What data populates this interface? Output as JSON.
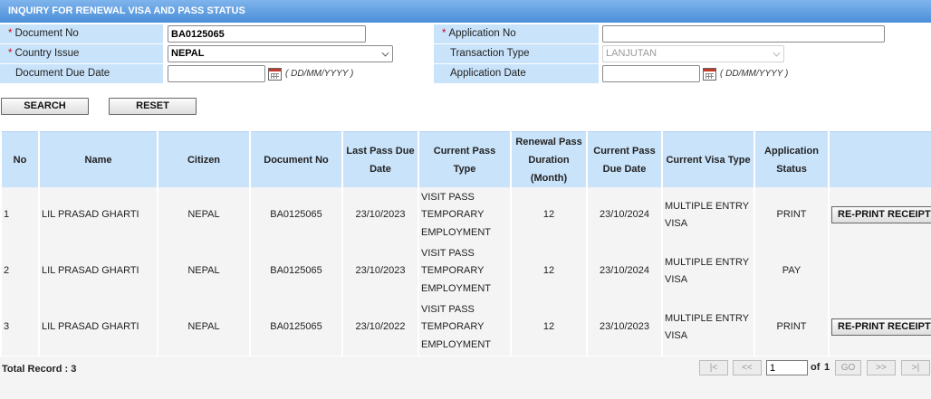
{
  "header": {
    "title": "INQUIRY FOR RENEWAL VISA AND PASS STATUS"
  },
  "form": {
    "required_mark": "*",
    "document_no": {
      "label": "Document No",
      "value": "BA0125065"
    },
    "application_no": {
      "label": "Application No",
      "value": ""
    },
    "country_issue": {
      "label": "Country Issue",
      "value": "NEPAL"
    },
    "transaction_type": {
      "label": "Transaction Type",
      "value": "LANJUTAN"
    },
    "document_due_date": {
      "label": "Document Due Date",
      "value": "",
      "hint": "( DD/MM/YYYY )"
    },
    "application_date": {
      "label": "Application Date",
      "value": "",
      "hint": "( DD/MM/YYYY )"
    },
    "search_label": "SEARCH",
    "reset_label": "RESET"
  },
  "table": {
    "headers": [
      "No",
      "Name",
      "Citizen",
      "Document No",
      "Last Pass Due Date",
      "Current Pass Type",
      "Renewal Pass Duration (Month)",
      "Current Pass Due Date",
      "Current Visa Type",
      "Application Status",
      ""
    ],
    "rows": [
      {
        "no": "1",
        "name": "LIL PRASAD GHARTI",
        "citizen": "NEPAL",
        "document_no": "BA0125065",
        "last_pass_due": "23/10/2023",
        "pass_type": "VISIT PASS TEMPORARY EMPLOYMENT",
        "duration": "12",
        "current_pass_due": "23/10/2024",
        "visa_type": "MULTIPLE ENTRY VISA",
        "status": "PRINT",
        "action": "RE-PRINT RECEIPT"
      },
      {
        "no": "2",
        "name": "LIL PRASAD GHARTI",
        "citizen": "NEPAL",
        "document_no": "BA0125065",
        "last_pass_due": "23/10/2023",
        "pass_type": "VISIT PASS TEMPORARY EMPLOYMENT",
        "duration": "12",
        "current_pass_due": "23/10/2024",
        "visa_type": "MULTIPLE ENTRY VISA",
        "status": "PAY",
        "action": ""
      },
      {
        "no": "3",
        "name": "LIL PRASAD GHARTI",
        "citizen": "NEPAL",
        "document_no": "BA0125065",
        "last_pass_due": "23/10/2022",
        "pass_type": "VISIT PASS TEMPORARY EMPLOYMENT",
        "duration": "12",
        "current_pass_due": "23/10/2023",
        "visa_type": "MULTIPLE ENTRY VISA",
        "status": "PRINT",
        "action": "RE-PRINT RECEIPT"
      }
    ]
  },
  "footer": {
    "total_record": "Total Record : 3",
    "first": "|<",
    "prev": "<<",
    "page": "1",
    "of": "of",
    "total_pages": "1",
    "go": "GO",
    "next": ">>",
    "last": ">|"
  }
}
